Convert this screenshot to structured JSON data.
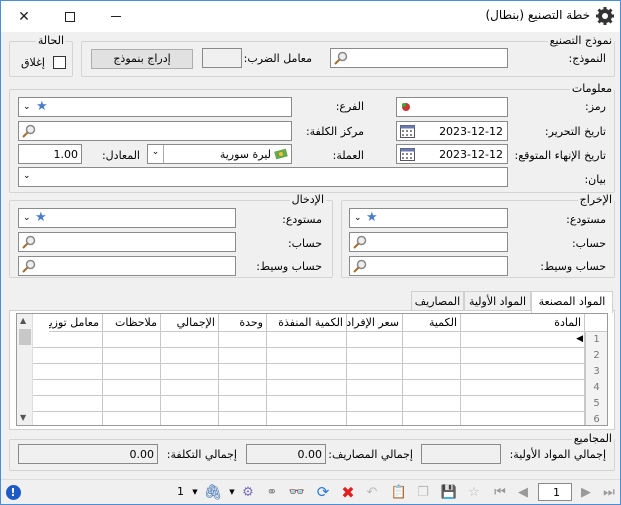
{
  "window": {
    "title": "خطة التصنيع (بنطال)"
  },
  "model_group": {
    "title": "نموذج التصنيع",
    "model_label": "النموذج:",
    "multiplier_label": "معامل الضرب:",
    "insert_button": "إدراج بنموذج",
    "model_value": "",
    "multiplier_value": ""
  },
  "status_group": {
    "title": "الحالة",
    "close_label": "إغلاق"
  },
  "info": {
    "title": "معلومات",
    "code_label": "رمز:",
    "branch_label": "الفرع:",
    "doc_date_label": "تاريخ التحرير:",
    "doc_date": "2023-12-12",
    "cost_center_label": "مركز الكلفة:",
    "end_date_label": "تاريخ الإنهاء المتوقع:",
    "end_date": "2023-12-12",
    "currency_label": "العملة:",
    "currency_value": "ليرة سورية",
    "rate_label": "المعادل:",
    "rate_value": "1.00",
    "statement_label": "بيان:"
  },
  "output": {
    "title": "الإخراج",
    "warehouse_label": "مستودع:",
    "account_label": "حساب:",
    "mid_account_label": "حساب وسيط:"
  },
  "input": {
    "title": "الإدخال",
    "warehouse_label": "مستودع:",
    "account_label": "حساب:",
    "mid_account_label": "حساب وسيط:"
  },
  "tabs": [
    "المواد المصنعة",
    "المواد الأولية",
    "المصاريف"
  ],
  "grid": {
    "columns": [
      "المادة",
      "الكمية",
      "سعر الإفراد",
      "الكمية المنفذة",
      "وحدة",
      "الإجمالي",
      "ملاحظات",
      "معامل توزيع"
    ],
    "rows": [
      "1",
      "2",
      "3",
      "4",
      "5",
      "6"
    ]
  },
  "totals": {
    "title": "المجاميع",
    "raw_label": "إجمالي المواد الأولية:",
    "raw_value": "",
    "expenses_label": "إجمالي المصاريف:",
    "expenses_value": "0.00",
    "cost_label": "إجمالي التكلفة:",
    "cost_value": "0.00"
  },
  "toolbar": {
    "page_value": "1",
    "attach_count": "1"
  }
}
